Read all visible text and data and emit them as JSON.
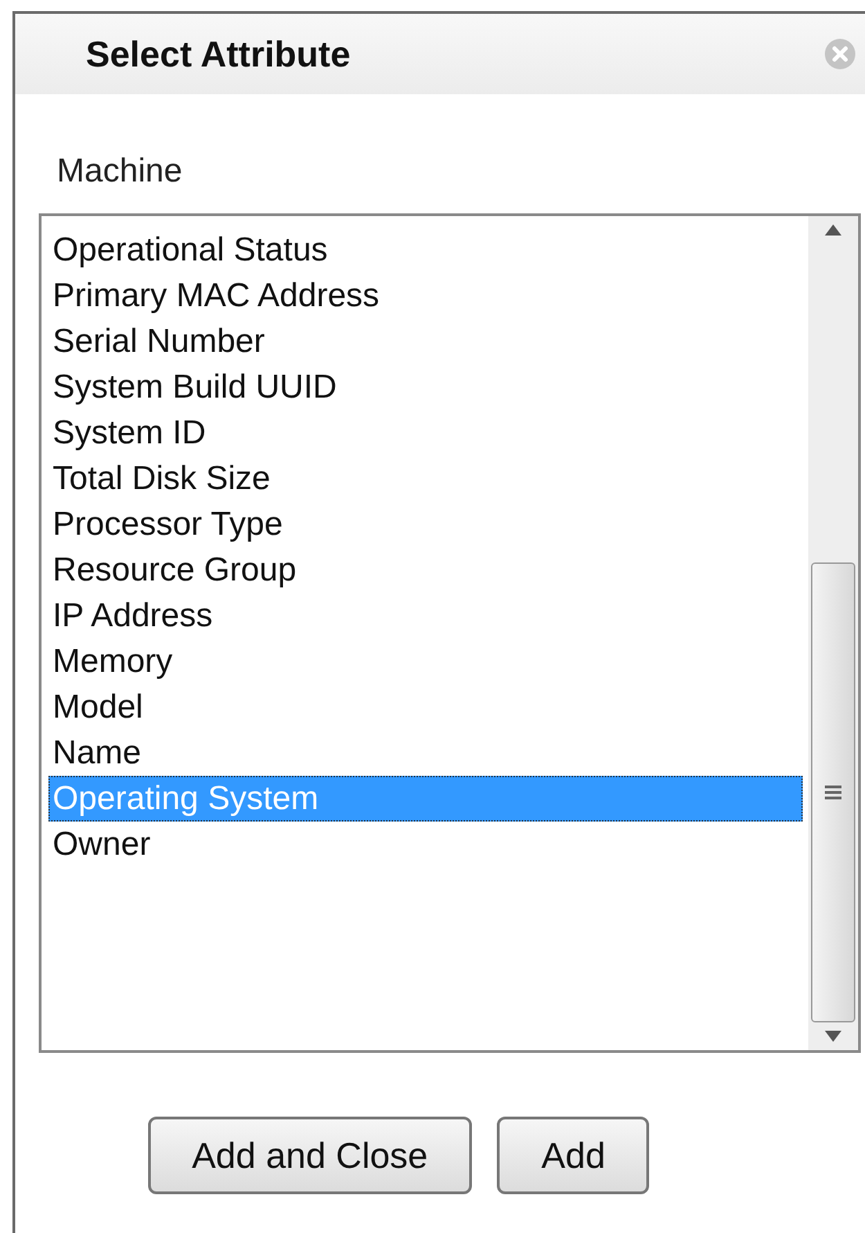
{
  "dialog": {
    "title": "Select Attribute"
  },
  "category": "Machine",
  "list": {
    "items": [
      {
        "label": "Operational Status",
        "selected": false
      },
      {
        "label": "Primary MAC Address",
        "selected": false
      },
      {
        "label": "Serial Number",
        "selected": false
      },
      {
        "label": "System Build UUID",
        "selected": false
      },
      {
        "label": "System ID",
        "selected": false
      },
      {
        "label": "Total Disk Size",
        "selected": false
      },
      {
        "label": "Processor Type",
        "selected": false
      },
      {
        "label": "Resource Group",
        "selected": false
      },
      {
        "label": "IP Address",
        "selected": false
      },
      {
        "label": "Memory",
        "selected": false
      },
      {
        "label": "Model",
        "selected": false
      },
      {
        "label": "Name",
        "selected": false
      },
      {
        "label": "Operating System",
        "selected": true
      },
      {
        "label": "Owner",
        "selected": false
      }
    ]
  },
  "buttons": [
    "Add and Close",
    "Add"
  ]
}
